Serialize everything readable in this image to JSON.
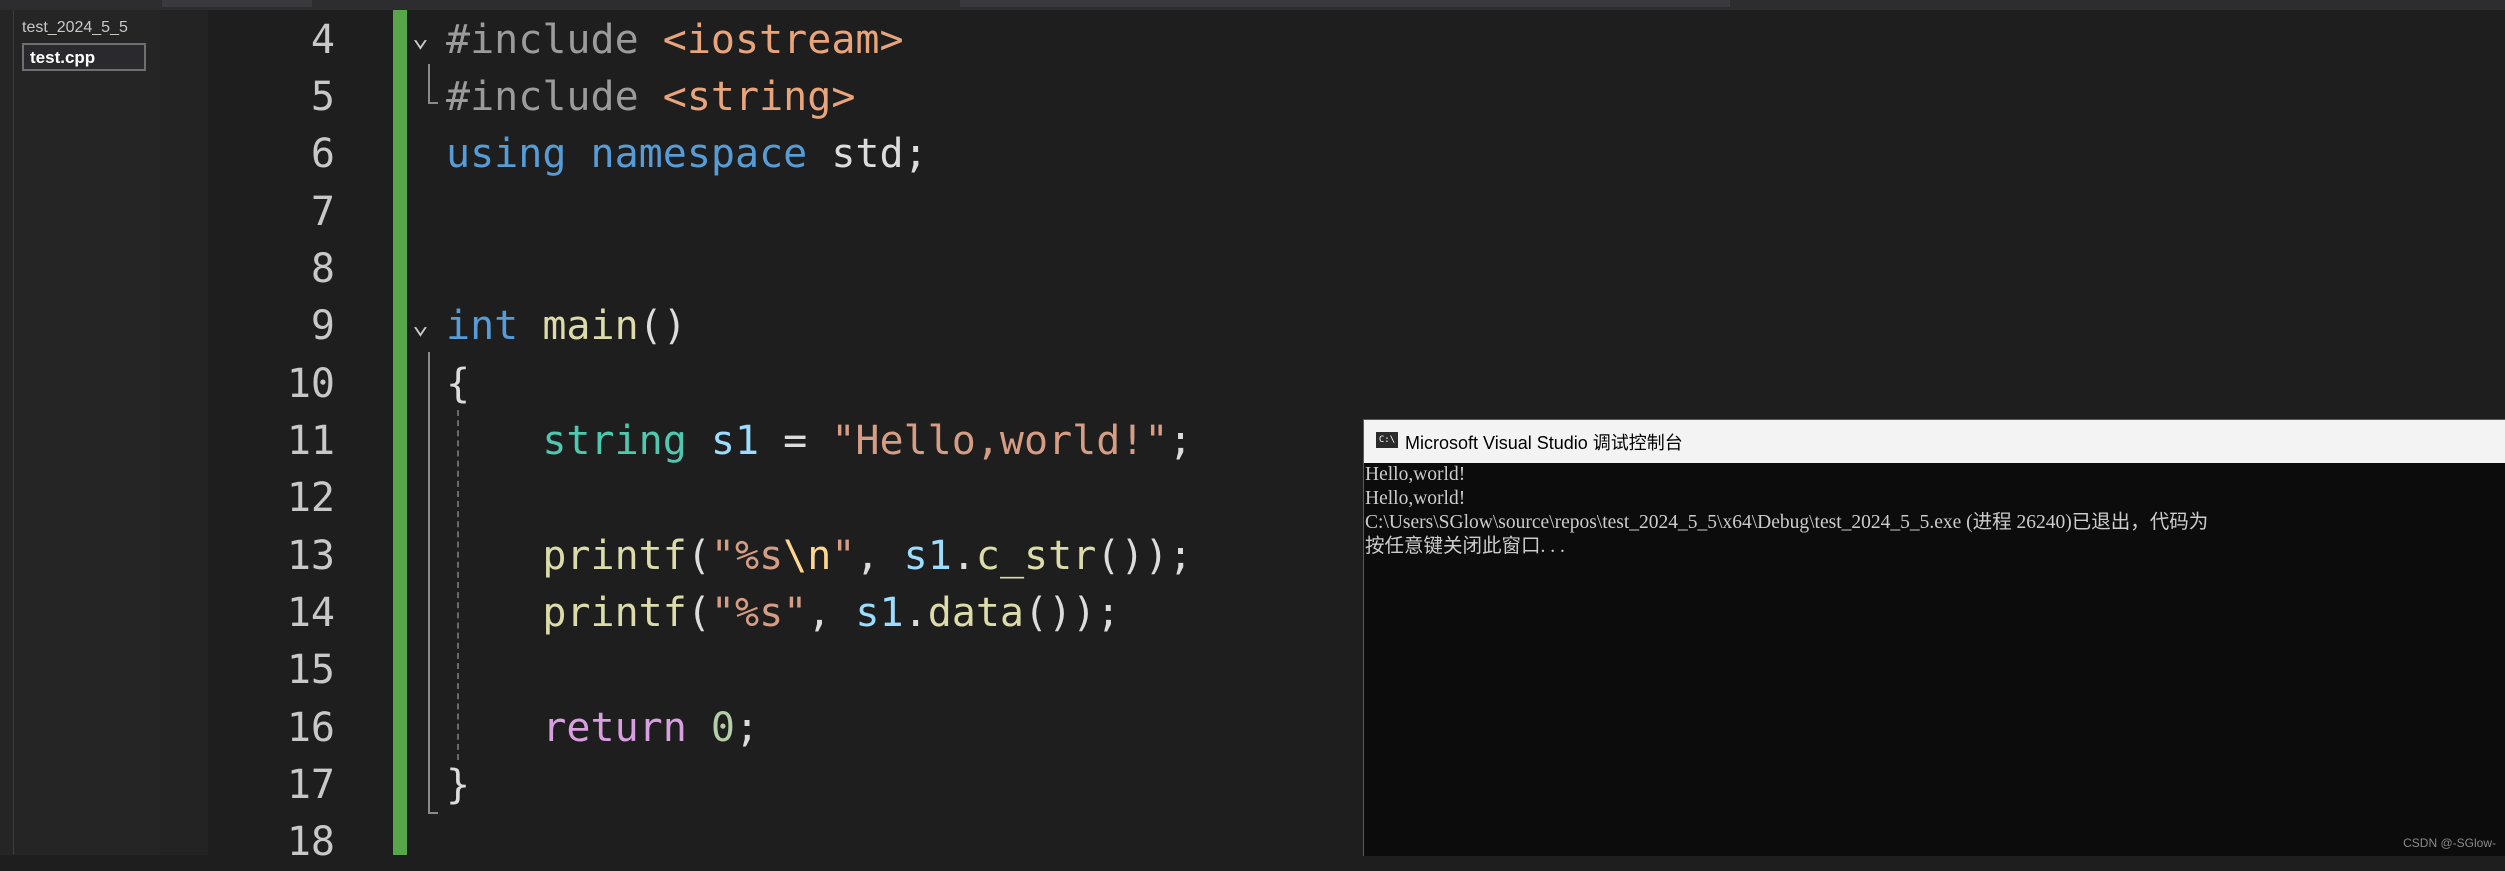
{
  "explorer": {
    "project": "test_2024_5_5",
    "file": "test.cpp"
  },
  "editor": {
    "line_numbers": [
      "4",
      "5",
      "6",
      "7",
      "8",
      "9",
      "10",
      "11",
      "12",
      "13",
      "14",
      "15",
      "16",
      "17",
      "18"
    ]
  },
  "console": {
    "title": "Microsoft Visual Studio 调试控制台",
    "icon_text": "C:\\",
    "lines": [
      "Hello,world!",
      "Hello,world!",
      "C:\\Users\\SGlow\\source\\repos\\test_2024_5_5\\x64\\Debug\\test_2024_5_5.exe (进程 26240)已退出，代码为",
      "按任意键关闭此窗口. . ."
    ]
  },
  "watermark": "CSDN @-SGlow-",
  "colors": {
    "change_bar": "#57a64a",
    "keyword": "#569cd6",
    "string": "#d69d85",
    "function": "#dcdcaa",
    "type": "#4ec9b0"
  }
}
